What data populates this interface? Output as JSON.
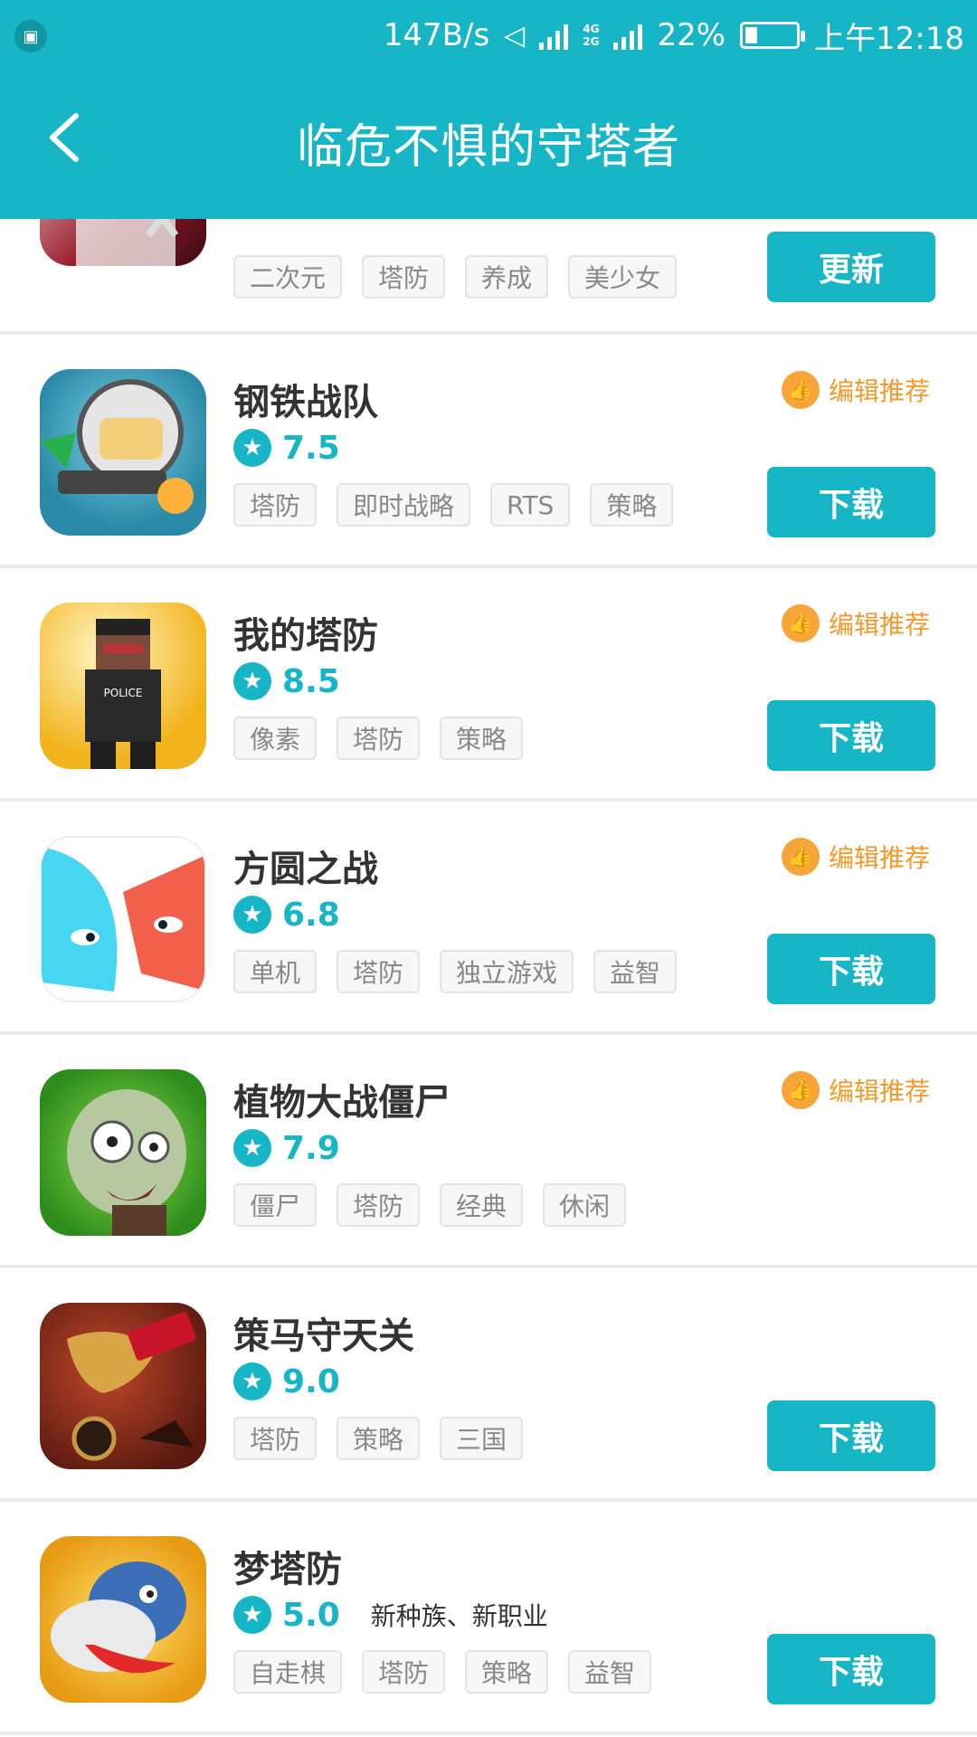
{
  "status_bar": {
    "speed": "147B/s",
    "network": [
      "4G",
      "2G"
    ],
    "battery": "22%",
    "time": "上午12:18"
  },
  "header": {
    "title": "临危不惧的守塔者"
  },
  "badge_text": "编辑推荐",
  "apps": [
    {
      "name": "",
      "score": "",
      "tags": [
        "二次元",
        "塔防",
        "养成",
        "美少女"
      ],
      "button": "更新",
      "recommended": false
    },
    {
      "name": "钢铁战队",
      "score": "7.5",
      "tags": [
        "塔防",
        "即时战略",
        "RTS",
        "策略"
      ],
      "button": "下载",
      "recommended": true
    },
    {
      "name": "我的塔防",
      "score": "8.5",
      "tags": [
        "像素",
        "塔防",
        "策略"
      ],
      "button": "下载",
      "recommended": true
    },
    {
      "name": "方圆之战",
      "score": "6.8",
      "tags": [
        "单机",
        "塔防",
        "独立游戏",
        "益智"
      ],
      "button": "下载",
      "recommended": true
    },
    {
      "name": "植物大战僵尸",
      "score": "7.9",
      "tags": [
        "僵尸",
        "塔防",
        "经典",
        "休闲"
      ],
      "button": "",
      "recommended": true
    },
    {
      "name": "策马守天关",
      "score": "9.0",
      "tags": [
        "塔防",
        "策略",
        "三国"
      ],
      "button": "下载",
      "recommended": false
    },
    {
      "name": "梦塔防",
      "score": "5.0",
      "desc": "新种族、新职业",
      "tags": [
        "自走棋",
        "塔防",
        "策略",
        "益智"
      ],
      "button": "下载",
      "recommended": false
    }
  ],
  "icons": [
    "back-arrow-icon",
    "star-icon",
    "thumbs-up-icon",
    "signal-icon",
    "battery-icon"
  ]
}
